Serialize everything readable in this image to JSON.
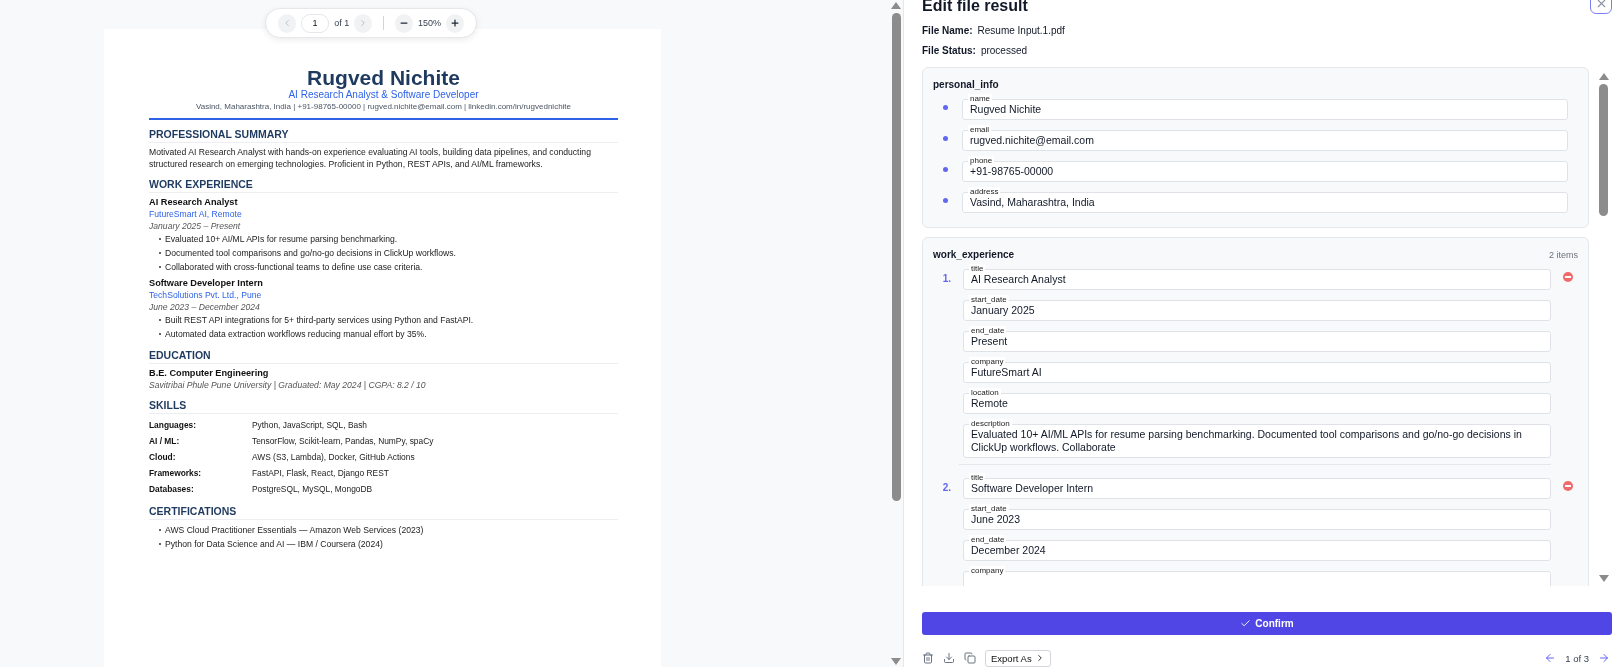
{
  "viewer": {
    "toolbar": {
      "prev_disabled": true,
      "next_disabled": true,
      "page": "1",
      "page_count": "of 1",
      "zoom": "150%"
    },
    "resume": {
      "name": "Rugved Nichite",
      "headline": "AI Research Analyst & Software Developer",
      "contact": "Vasind, Maharashtra, India | +91-98765-00000 | rugved.nichite@email.com | linkedin.com/in/rugvednichite",
      "sections": [
        {
          "kind": "text",
          "title": "PROFESSIONAL SUMMARY",
          "text": "Motivated AI Research Analyst with hands-on experience evaluating AI tools, building data pipelines, and conducting structured research on emerging technologies. Proficient in Python, REST APIs, and AI/ML frameworks."
        },
        {
          "kind": "jobs",
          "title": "WORK EXPERIENCE",
          "jobs": [
            {
              "role": "AI Research Analyst",
              "company": "FutureSmart AI, Remote",
              "dates": "January 2025 – Present",
              "bullets": [
                "Evaluated 10+ AI/ML APIs for resume parsing benchmarking.",
                "Documented tool comparisons and go/no-go decisions in ClickUp workflows.",
                "Collaborated with cross-functional teams to define use case criteria."
              ]
            },
            {
              "role": "Software Developer Intern",
              "company": "TechSolutions Pvt. Ltd., Pune",
              "dates": "June 2023 – December 2024",
              "bullets": [
                "Built REST API integrations for 5+ third-party services using Python and FastAPI.",
                "Automated data extraction workflows reducing manual effort by 35%."
              ]
            }
          ]
        },
        {
          "kind": "education",
          "title": "EDUCATION",
          "entries": [
            {
              "degree": "B.E. Computer Engineering",
              "details": "Savitribai Phule Pune University | Graduated: May 2024 | CGPA: 8.2 / 10"
            }
          ]
        },
        {
          "kind": "skills",
          "title": "SKILLS",
          "rows": [
            {
              "label": "Languages:",
              "value": "Python, JavaScript, SQL, Bash"
            },
            {
              "label": "AI / ML:",
              "value": "TensorFlow, Scikit-learn, Pandas, NumPy, spaCy"
            },
            {
              "label": "Cloud:",
              "value": "AWS (S3, Lambda), Docker, GitHub Actions"
            },
            {
              "label": "Frameworks:",
              "value": "FastAPI, Flask, React, Django REST"
            },
            {
              "label": "Databases:",
              "value": "PostgreSQL, MySQL, MongoDB"
            }
          ]
        },
        {
          "kind": "list",
          "title": "CERTIFICATIONS",
          "items": [
            "AWS Cloud Practitioner Essentials — Amazon Web Services (2023)",
            "Python for Data Science and AI — IBM / Coursera (2024)"
          ]
        }
      ]
    }
  },
  "panel": {
    "title": "Edit file result",
    "meta": [
      {
        "label": "File Name:",
        "value": "Resume Input.1.pdf"
      },
      {
        "label": "File Status:",
        "value": "processed"
      }
    ],
    "sections": [
      {
        "kind": "object",
        "title": "personal_info",
        "fields": [
          {
            "label": "name",
            "value": "Rugved Nichite"
          },
          {
            "label": "email",
            "value": "rugved.nichite@email.com"
          },
          {
            "label": "phone",
            "value": "+91-98765-00000"
          },
          {
            "label": "address",
            "value": "Vasind, Maharashtra, India"
          }
        ]
      },
      {
        "kind": "array",
        "title": "work_experience",
        "count": "2 items",
        "items": [
          {
            "number": "1.",
            "fields": [
              {
                "label": "title",
                "value": "AI Research Analyst"
              },
              {
                "label": "start_date",
                "value": "January 2025"
              },
              {
                "label": "end_date",
                "value": "Present"
              },
              {
                "label": "company",
                "value": "FutureSmart AI"
              },
              {
                "label": "location",
                "value": "Remote"
              },
              {
                "label": "description",
                "value": "Evaluated 10+ AI/ML APIs for resume parsing benchmarking. Documented tool comparisons and go/no-go decisions in ClickUp workflows. Collaborate"
              }
            ]
          },
          {
            "number": "2.",
            "fields": [
              {
                "label": "title",
                "value": "Software Developer Intern"
              },
              {
                "label": "start_date",
                "value": "June 2023"
              },
              {
                "label": "end_date",
                "value": "December 2024"
              },
              {
                "label": "company"
              }
            ]
          }
        ]
      }
    ],
    "confirm": "Confirm",
    "export": "Export As",
    "pager": "1 of 3"
  }
}
